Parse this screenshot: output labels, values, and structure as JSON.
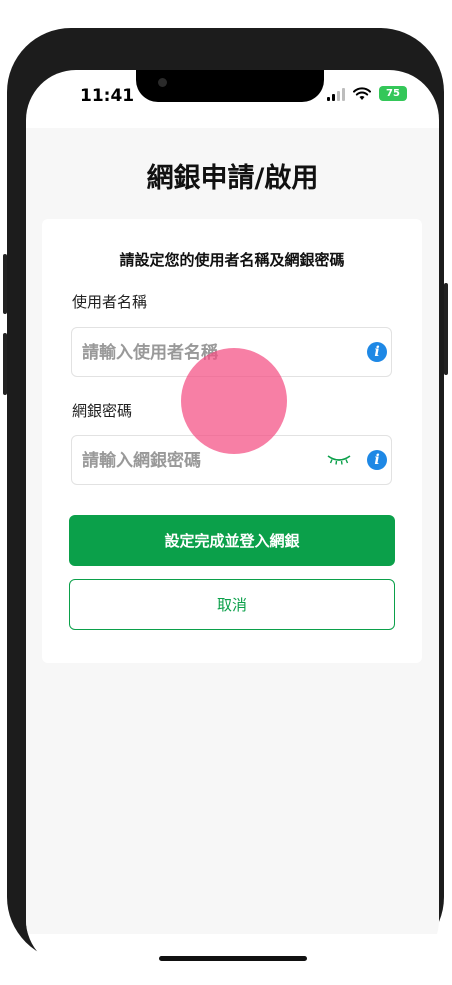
{
  "status_bar": {
    "time": "11:41",
    "battery_level": "75",
    "battery_color": "#34c759",
    "icons": [
      "cellular-signal-icon",
      "wifi-icon",
      "battery-icon"
    ]
  },
  "page": {
    "title": "網銀申請/啟用"
  },
  "form": {
    "subtitle": "請設定您的使用者名稱及網銀密碼",
    "username": {
      "label": "使用者名稱",
      "placeholder": "請輸入使用者名稱",
      "value": ""
    },
    "password": {
      "label": "網銀密碼",
      "placeholder": "請輸入網銀密碼",
      "value": ""
    },
    "submit_label": "設定完成並登入網銀",
    "cancel_label": "取消"
  },
  "colors": {
    "primary": "#0ba04a",
    "info": "#1e88e5",
    "touch_indicator": "#f44e82"
  }
}
